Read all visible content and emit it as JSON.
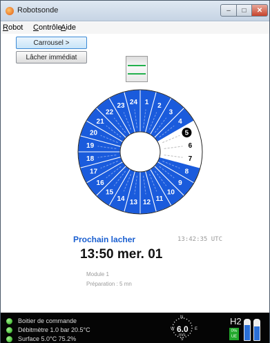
{
  "window": {
    "title": "Robotsonde",
    "controls": {
      "minimize": "–",
      "maximize": "□",
      "close": "✕"
    }
  },
  "menu": [
    {
      "prefix": "R",
      "rest": "obot"
    },
    {
      "prefix": "C",
      "rest": "ontrôle"
    },
    {
      "prefix": "A",
      "rest": "ide"
    }
  ],
  "buttons": {
    "carousel": "Carrousel >",
    "release_now": "Lâcher immédiat"
  },
  "carousel": {
    "slots": [
      {
        "n": "1",
        "state": "loaded"
      },
      {
        "n": "2",
        "state": "loaded"
      },
      {
        "n": "3",
        "state": "loaded"
      },
      {
        "n": "4",
        "state": "loaded"
      },
      {
        "n": "5",
        "state": "next"
      },
      {
        "n": "6",
        "state": "empty"
      },
      {
        "n": "7",
        "state": "empty"
      },
      {
        "n": "8",
        "state": "loaded"
      },
      {
        "n": "9",
        "state": "loaded"
      },
      {
        "n": "10",
        "state": "loaded"
      },
      {
        "n": "11",
        "state": "loaded"
      },
      {
        "n": "12",
        "state": "loaded"
      },
      {
        "n": "13",
        "state": "loaded"
      },
      {
        "n": "14",
        "state": "loaded"
      },
      {
        "n": "15",
        "state": "loaded"
      },
      {
        "n": "16",
        "state": "loaded"
      },
      {
        "n": "17",
        "state": "loaded"
      },
      {
        "n": "18",
        "state": "loaded"
      },
      {
        "n": "19",
        "state": "loaded"
      },
      {
        "n": "20",
        "state": "loaded"
      },
      {
        "n": "21",
        "state": "loaded"
      },
      {
        "n": "22",
        "state": "loaded"
      },
      {
        "n": "23",
        "state": "loaded"
      },
      {
        "n": "24",
        "state": "loaded"
      }
    ],
    "colors": {
      "loaded": "#1a5bdc",
      "empty": "#ffffff",
      "next": "#ffffff"
    }
  },
  "next_release": {
    "label": "Prochain lacher",
    "utc_time": "13:42:35 UTC",
    "time": "13:50 mer. 01",
    "module": "Module 1",
    "preparation": "Préparation : 5 mn"
  },
  "status": {
    "items": [
      "Boitier de commande",
      "Débitmètre  1.0 bar  20.5°C",
      "Surface 5.0°C 75.2%"
    ],
    "wind": {
      "value": "6.0",
      "unit": "m/s",
      "n": "N",
      "s": "S",
      "w": "W",
      "e": "E"
    },
    "h2": {
      "label": "H2",
      "percent": "0%",
      "ue": "UE"
    }
  }
}
